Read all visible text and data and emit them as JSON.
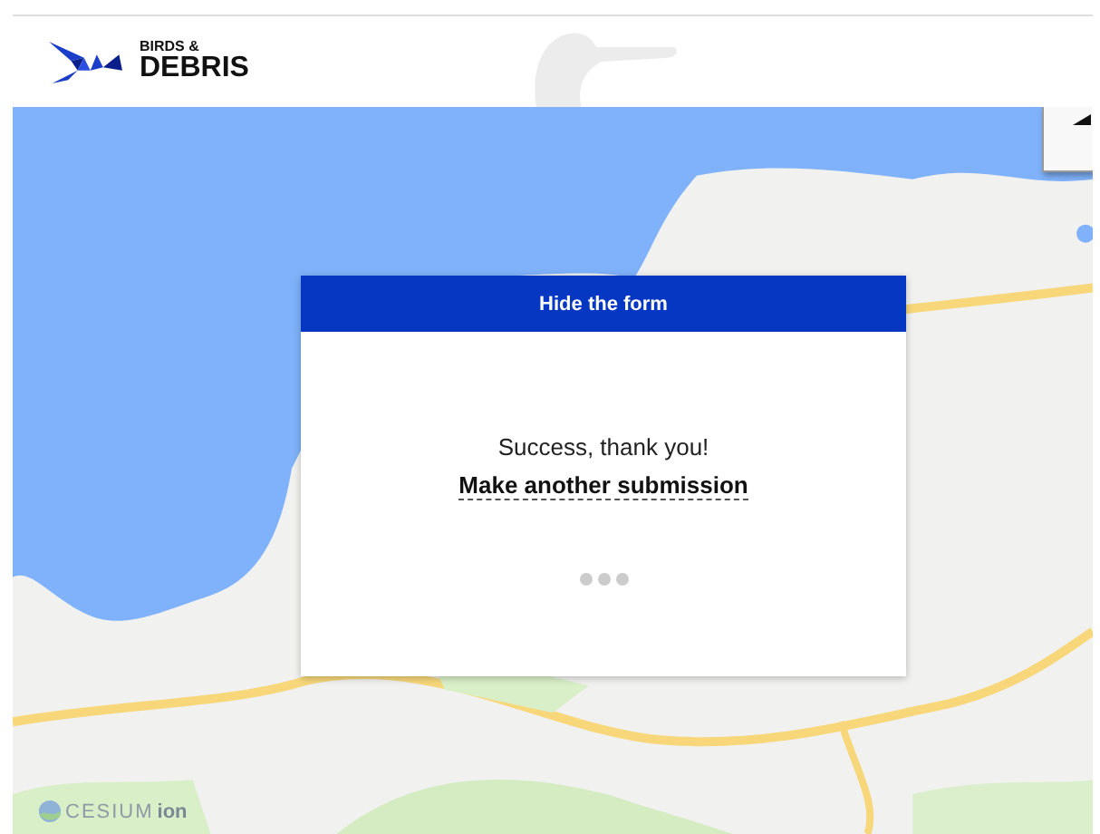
{
  "header": {
    "logo_top": "BIRDS &",
    "logo_bottom": "DEBRIS"
  },
  "map": {
    "kind": "picture",
    "credit_brand": "CESIUM",
    "credit_suffix": "ion"
  },
  "dialog": {
    "header_button": "Hide the form",
    "message": "Success, thank you!",
    "link": "Make another submission",
    "loading": true
  }
}
